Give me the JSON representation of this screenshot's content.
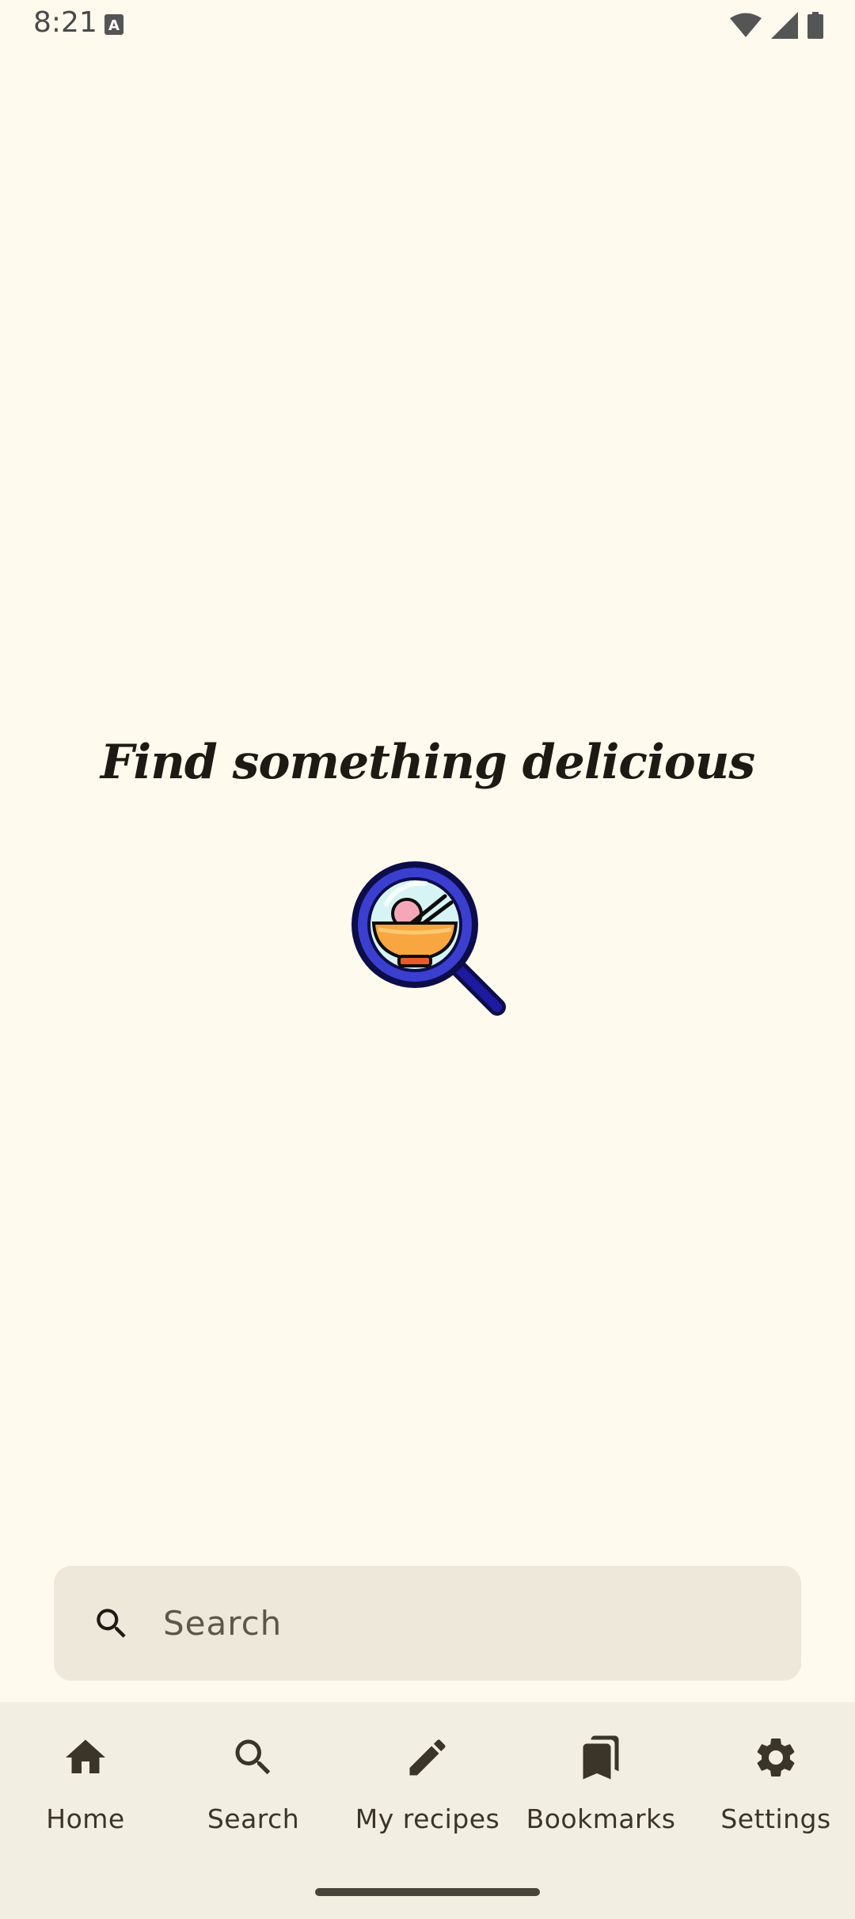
{
  "status_bar": {
    "time": "8:21",
    "icons": [
      "text-notification-icon",
      "wifi-icon",
      "signal-icon",
      "battery-icon"
    ]
  },
  "hero": {
    "title": "Find something delicious",
    "illustration": "magnifier-food-bowl-illustration"
  },
  "search": {
    "placeholder": "Search",
    "icon": "search-icon"
  },
  "bottom_nav": {
    "items": [
      {
        "label": "Home",
        "icon": "home-icon"
      },
      {
        "label": "Search",
        "icon": "search-icon"
      },
      {
        "label": "My recipes",
        "icon": "pencil-icon"
      },
      {
        "label": "Bookmarks",
        "icon": "bookmarks-icon"
      },
      {
        "label": "Settings",
        "icon": "gear-icon"
      }
    ]
  },
  "colors": {
    "background": "#FFFAEE",
    "search_bar": "#EEE8DA",
    "nav_background": "#F3EEE2",
    "icon": "#3b3529"
  }
}
